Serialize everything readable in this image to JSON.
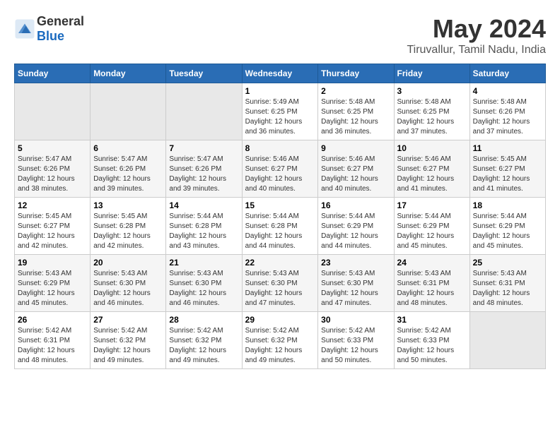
{
  "header": {
    "logo_general": "General",
    "logo_blue": "Blue",
    "month_year": "May 2024",
    "location": "Tiruvallur, Tamil Nadu, India"
  },
  "calendar": {
    "days_of_week": [
      "Sunday",
      "Monday",
      "Tuesday",
      "Wednesday",
      "Thursday",
      "Friday",
      "Saturday"
    ],
    "weeks": [
      [
        {
          "day": "",
          "info": ""
        },
        {
          "day": "",
          "info": ""
        },
        {
          "day": "",
          "info": ""
        },
        {
          "day": "1",
          "info": "Sunrise: 5:49 AM\nSunset: 6:25 PM\nDaylight: 12 hours\nand 36 minutes."
        },
        {
          "day": "2",
          "info": "Sunrise: 5:48 AM\nSunset: 6:25 PM\nDaylight: 12 hours\nand 36 minutes."
        },
        {
          "day": "3",
          "info": "Sunrise: 5:48 AM\nSunset: 6:25 PM\nDaylight: 12 hours\nand 37 minutes."
        },
        {
          "day": "4",
          "info": "Sunrise: 5:48 AM\nSunset: 6:26 PM\nDaylight: 12 hours\nand 37 minutes."
        }
      ],
      [
        {
          "day": "5",
          "info": "Sunrise: 5:47 AM\nSunset: 6:26 PM\nDaylight: 12 hours\nand 38 minutes."
        },
        {
          "day": "6",
          "info": "Sunrise: 5:47 AM\nSunset: 6:26 PM\nDaylight: 12 hours\nand 39 minutes."
        },
        {
          "day": "7",
          "info": "Sunrise: 5:47 AM\nSunset: 6:26 PM\nDaylight: 12 hours\nand 39 minutes."
        },
        {
          "day": "8",
          "info": "Sunrise: 5:46 AM\nSunset: 6:27 PM\nDaylight: 12 hours\nand 40 minutes."
        },
        {
          "day": "9",
          "info": "Sunrise: 5:46 AM\nSunset: 6:27 PM\nDaylight: 12 hours\nand 40 minutes."
        },
        {
          "day": "10",
          "info": "Sunrise: 5:46 AM\nSunset: 6:27 PM\nDaylight: 12 hours\nand 41 minutes."
        },
        {
          "day": "11",
          "info": "Sunrise: 5:45 AM\nSunset: 6:27 PM\nDaylight: 12 hours\nand 41 minutes."
        }
      ],
      [
        {
          "day": "12",
          "info": "Sunrise: 5:45 AM\nSunset: 6:27 PM\nDaylight: 12 hours\nand 42 minutes."
        },
        {
          "day": "13",
          "info": "Sunrise: 5:45 AM\nSunset: 6:28 PM\nDaylight: 12 hours\nand 42 minutes."
        },
        {
          "day": "14",
          "info": "Sunrise: 5:44 AM\nSunset: 6:28 PM\nDaylight: 12 hours\nand 43 minutes."
        },
        {
          "day": "15",
          "info": "Sunrise: 5:44 AM\nSunset: 6:28 PM\nDaylight: 12 hours\nand 44 minutes."
        },
        {
          "day": "16",
          "info": "Sunrise: 5:44 AM\nSunset: 6:29 PM\nDaylight: 12 hours\nand 44 minutes."
        },
        {
          "day": "17",
          "info": "Sunrise: 5:44 AM\nSunset: 6:29 PM\nDaylight: 12 hours\nand 45 minutes."
        },
        {
          "day": "18",
          "info": "Sunrise: 5:44 AM\nSunset: 6:29 PM\nDaylight: 12 hours\nand 45 minutes."
        }
      ],
      [
        {
          "day": "19",
          "info": "Sunrise: 5:43 AM\nSunset: 6:29 PM\nDaylight: 12 hours\nand 45 minutes."
        },
        {
          "day": "20",
          "info": "Sunrise: 5:43 AM\nSunset: 6:30 PM\nDaylight: 12 hours\nand 46 minutes."
        },
        {
          "day": "21",
          "info": "Sunrise: 5:43 AM\nSunset: 6:30 PM\nDaylight: 12 hours\nand 46 minutes."
        },
        {
          "day": "22",
          "info": "Sunrise: 5:43 AM\nSunset: 6:30 PM\nDaylight: 12 hours\nand 47 minutes."
        },
        {
          "day": "23",
          "info": "Sunrise: 5:43 AM\nSunset: 6:30 PM\nDaylight: 12 hours\nand 47 minutes."
        },
        {
          "day": "24",
          "info": "Sunrise: 5:43 AM\nSunset: 6:31 PM\nDaylight: 12 hours\nand 48 minutes."
        },
        {
          "day": "25",
          "info": "Sunrise: 5:43 AM\nSunset: 6:31 PM\nDaylight: 12 hours\nand 48 minutes."
        }
      ],
      [
        {
          "day": "26",
          "info": "Sunrise: 5:42 AM\nSunset: 6:31 PM\nDaylight: 12 hours\nand 48 minutes."
        },
        {
          "day": "27",
          "info": "Sunrise: 5:42 AM\nSunset: 6:32 PM\nDaylight: 12 hours\nand 49 minutes."
        },
        {
          "day": "28",
          "info": "Sunrise: 5:42 AM\nSunset: 6:32 PM\nDaylight: 12 hours\nand 49 minutes."
        },
        {
          "day": "29",
          "info": "Sunrise: 5:42 AM\nSunset: 6:32 PM\nDaylight: 12 hours\nand 49 minutes."
        },
        {
          "day": "30",
          "info": "Sunrise: 5:42 AM\nSunset: 6:33 PM\nDaylight: 12 hours\nand 50 minutes."
        },
        {
          "day": "31",
          "info": "Sunrise: 5:42 AM\nSunset: 6:33 PM\nDaylight: 12 hours\nand 50 minutes."
        },
        {
          "day": "",
          "info": ""
        }
      ]
    ]
  }
}
